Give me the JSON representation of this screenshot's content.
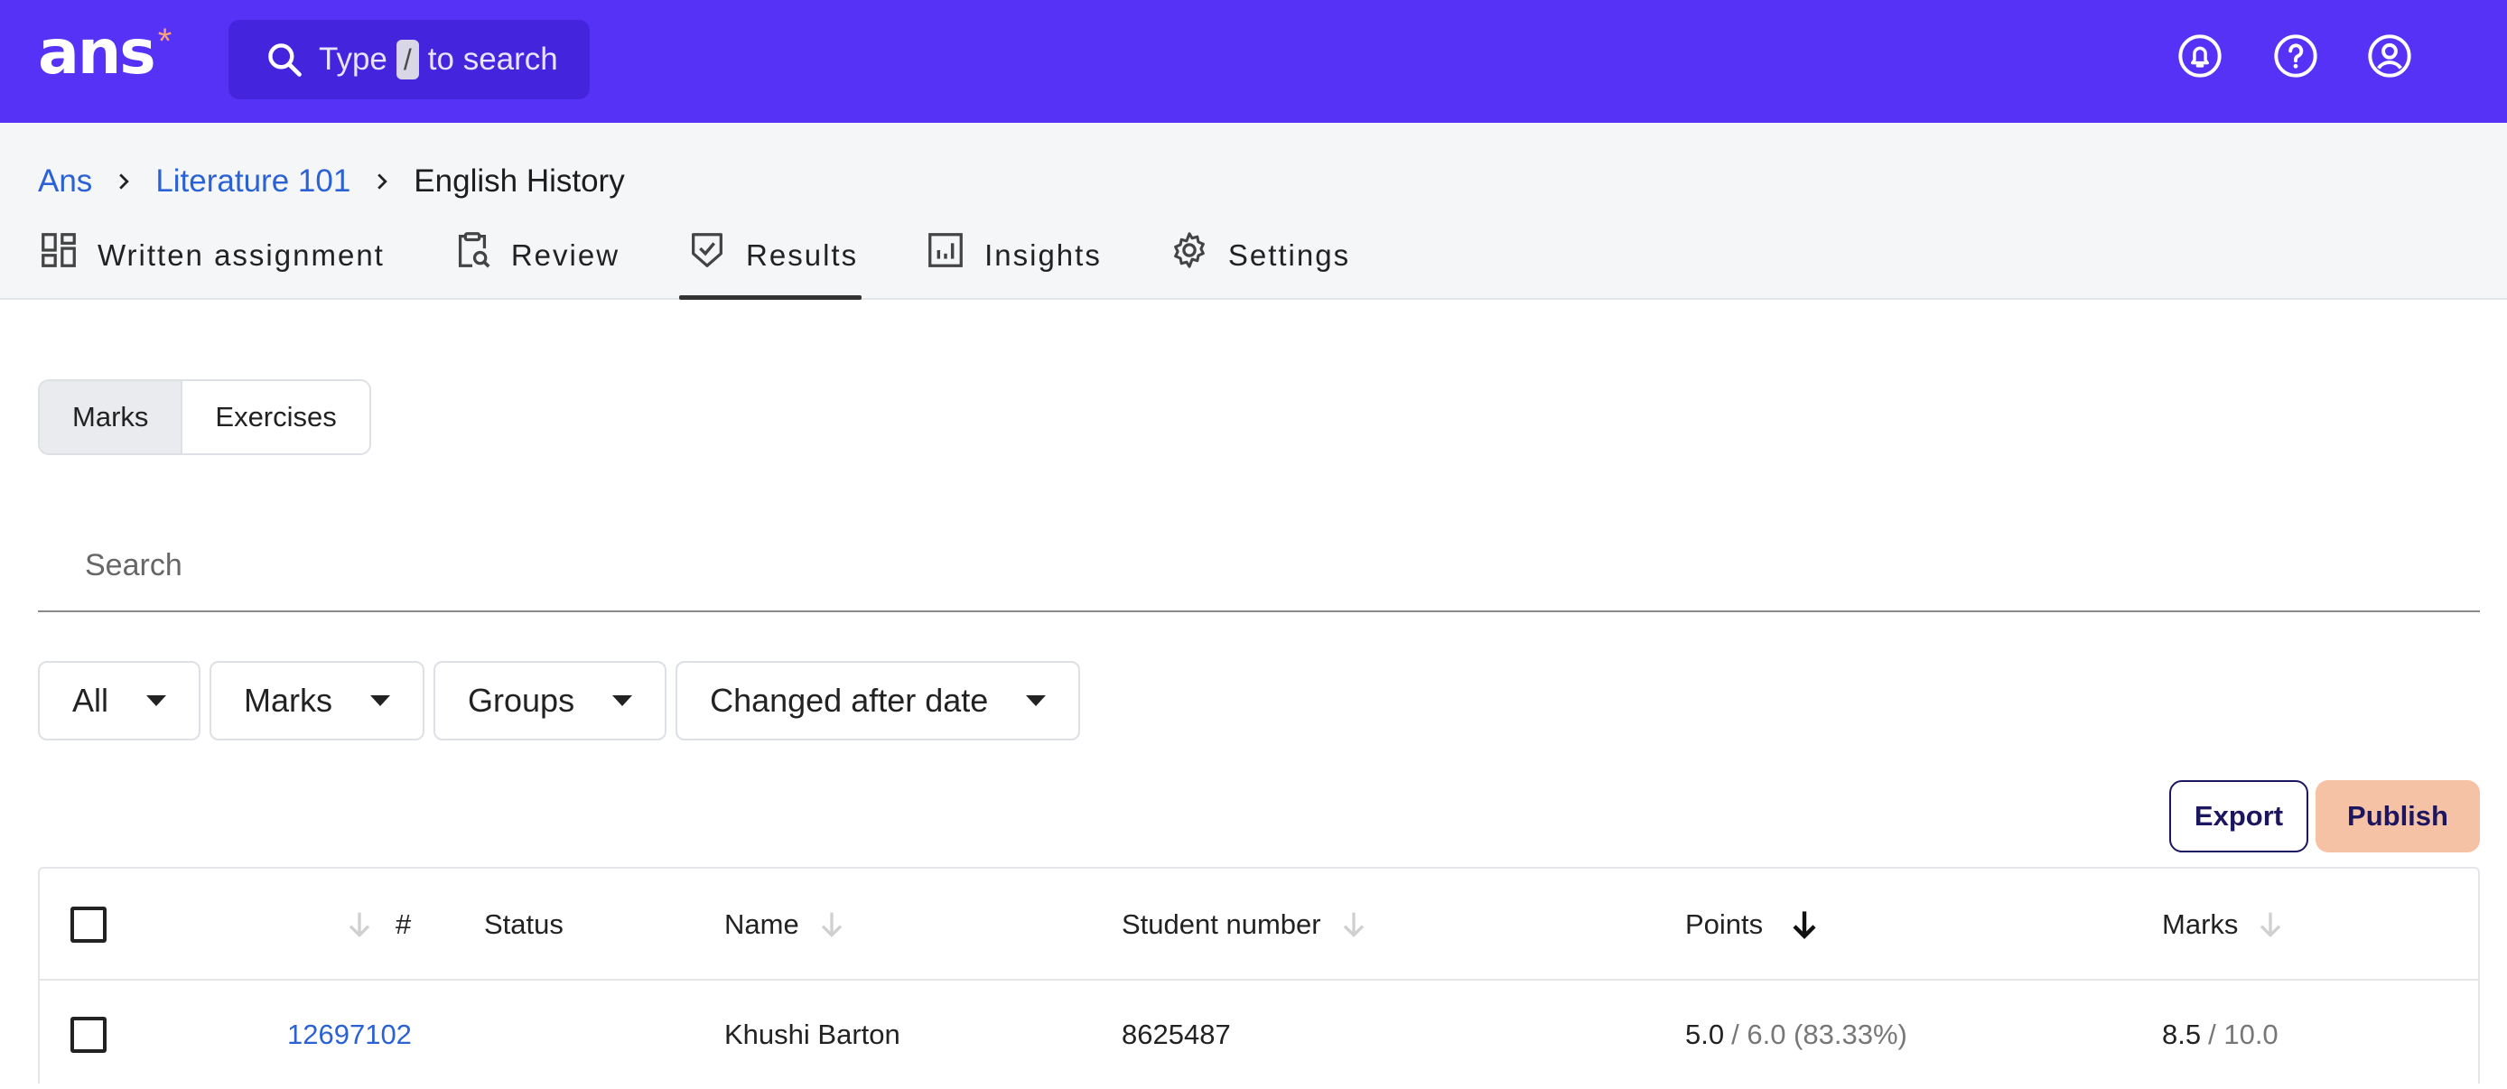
{
  "header": {
    "logo_text": "ans",
    "logo_star": "*",
    "search": {
      "prefix": "Type",
      "key": "/",
      "suffix": "to search"
    },
    "icons": [
      "notification-bell-icon",
      "help-icon",
      "account-icon"
    ]
  },
  "breadcrumb": [
    "Ans",
    "Literature 101",
    "English History"
  ],
  "tabs": [
    {
      "label": "Written assignment",
      "icon": "dashboard-icon"
    },
    {
      "label": "Review",
      "icon": "clipboard-search-icon"
    },
    {
      "label": "Results",
      "icon": "shield-check-icon",
      "active": true
    },
    {
      "label": "Insights",
      "icon": "bar-chart-icon"
    },
    {
      "label": "Settings",
      "icon": "gear-icon"
    }
  ],
  "segmented": {
    "marks": "Marks",
    "exercises": "Exercises",
    "selected": "Marks"
  },
  "search": {
    "placeholder": "Search",
    "value": ""
  },
  "filters": {
    "all": "All",
    "marks": "Marks",
    "groups": "Groups",
    "changed": "Changed after date"
  },
  "actions": {
    "export": "Export",
    "publish": "Publish"
  },
  "colors": {
    "topbar": "#5532f5",
    "link": "#2a62d6",
    "publish": "#f5c2a6",
    "accent_star": "#f7a07c"
  },
  "table": {
    "columns": {
      "number": "#",
      "status": "Status",
      "name": "Name",
      "student_number": "Student number",
      "points": "Points",
      "marks": "Marks"
    },
    "rows": [
      {
        "id": "12697102",
        "status": "",
        "name": "Khushi Barton",
        "student_number": "8625487",
        "points": "5.0",
        "points_total": "/ 6.0 (83.33%)",
        "marks": "8.5",
        "marks_total": "/ 10.0"
      }
    ]
  }
}
